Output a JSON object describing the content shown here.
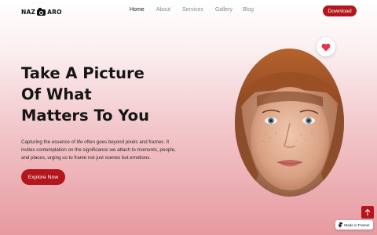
{
  "brand": {
    "left": "NAZ",
    "right": "ARO"
  },
  "nav": {
    "items": [
      {
        "label": "Home",
        "active": true
      },
      {
        "label": "About",
        "active": false
      },
      {
        "label": "Services",
        "active": false
      },
      {
        "label": "Gallery",
        "active": false
      },
      {
        "label": "Blog",
        "active": false
      }
    ],
    "download_label": "Download"
  },
  "hero": {
    "title_lines": [
      "Take A Picture",
      "Of What",
      "Matters To You"
    ],
    "description": "Capturing the essence of life often goes beyond pixels and frames. It invites contemplation on the significance we attach to moments, people, and places, urging us to frame not just scenes but emotions.",
    "cta_label": "Explore Now"
  },
  "badges": {
    "framer_label": "Made in Framer"
  },
  "colors": {
    "accent": "#b3161d",
    "heart": "#e8334a",
    "gradient_bottom": "#e79aa0"
  },
  "icons": [
    "camera-logo-icon",
    "heart-icon",
    "arrow-up-icon",
    "framer-icon"
  ]
}
